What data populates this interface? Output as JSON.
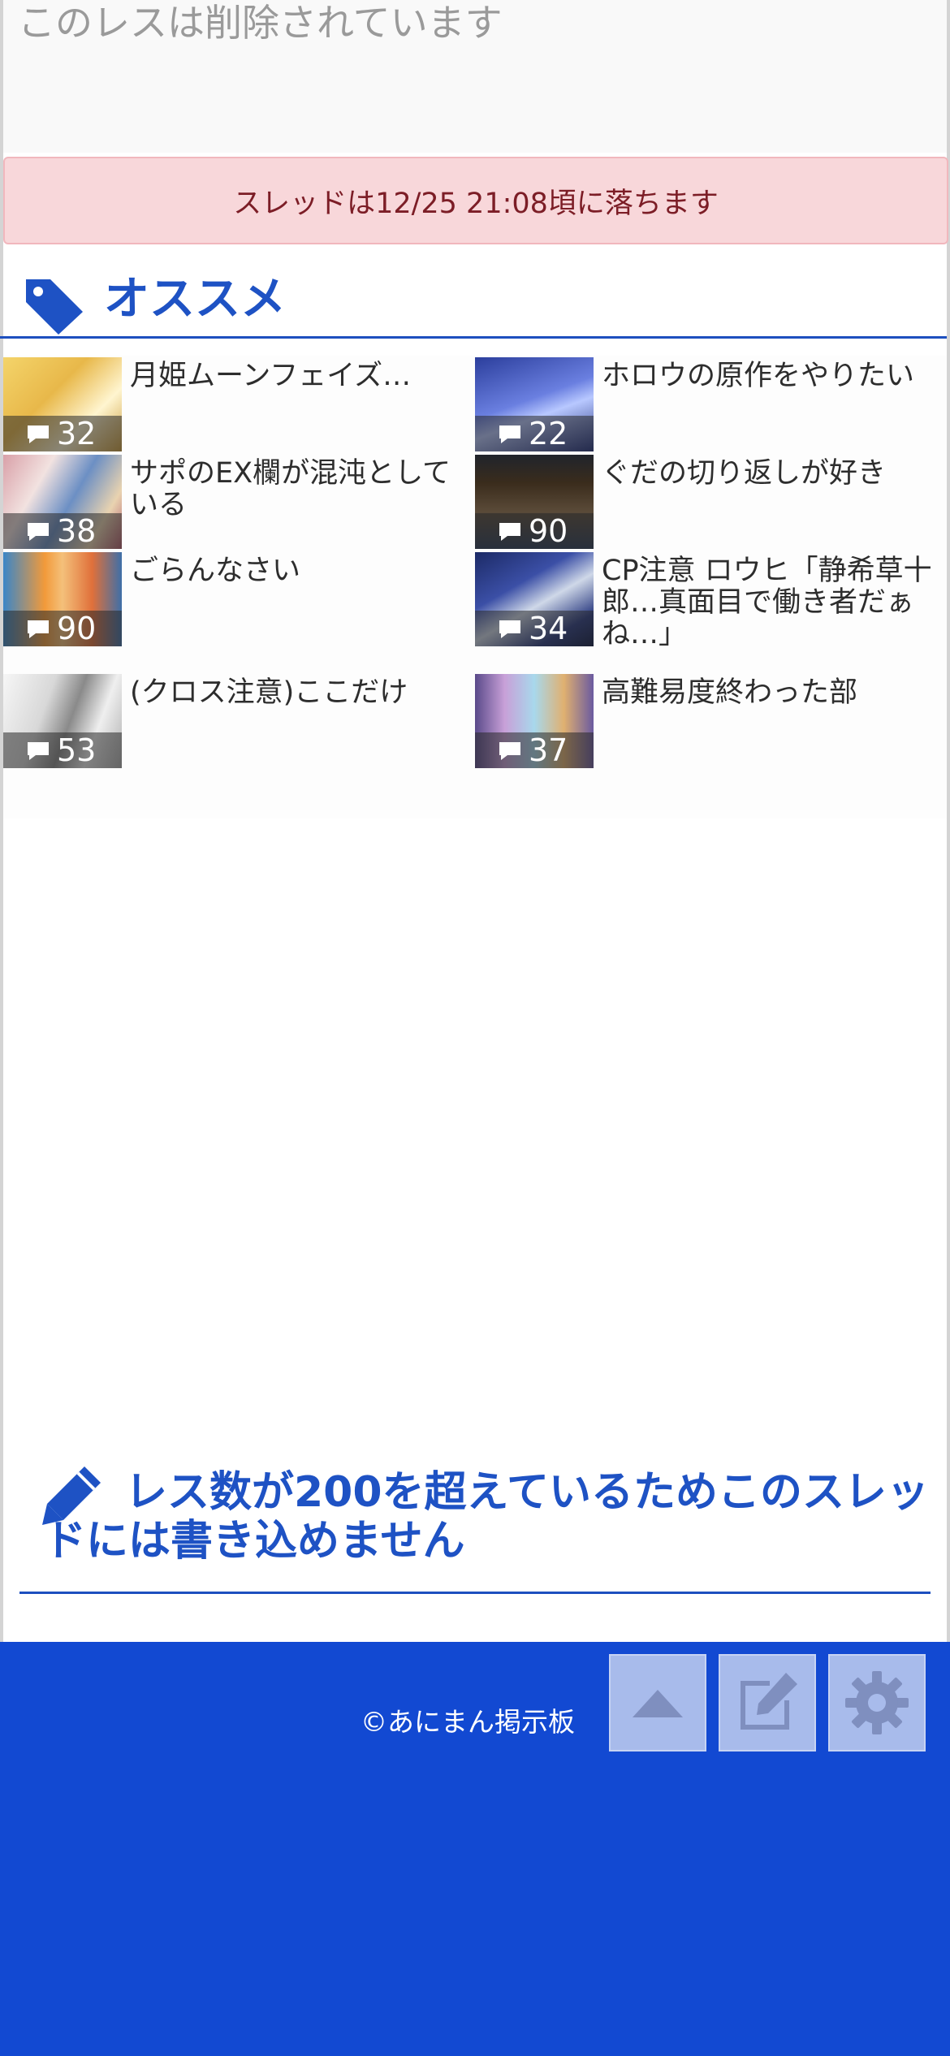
{
  "deleted_post": {
    "text": "このレスは削除されています"
  },
  "thread_notice": {
    "text": "スレッドは12/25 21:08頃に落ちます"
  },
  "recommend": {
    "title": "オススメ",
    "items": [
      {
        "title": "月姫ムーンフェイズ…",
        "count": "32"
      },
      {
        "title": "ホロウの原作をやりたい",
        "count": "22"
      },
      {
        "title": "サポのEX欄が混沌としている",
        "count": "38"
      },
      {
        "title": "ぐだの切り返しが好き",
        "count": "90"
      },
      {
        "title": "ごらんなさい",
        "count": "90"
      },
      {
        "title": "CP注意 ロウヒ「静希草十郎…真面目で働き者だぁね…」",
        "count": "34"
      },
      {
        "title": "(クロス注意)ここだけ",
        "count": "53"
      },
      {
        "title": "高難易度終わった部",
        "count": "37"
      }
    ]
  },
  "no_write": {
    "text": "レス数が200を超えているためこのスレッドには書き込めません"
  },
  "footer": {
    "copyright": "©あにまん掲示板",
    "buttons": {
      "top_icon": "caret-up-icon",
      "write_icon": "edit-icon",
      "settings_icon": "gear-icon"
    }
  },
  "colors": {
    "accent": "#1e52c4",
    "footer_bg": "#1249d2",
    "alert_bg": "#f8d7da",
    "alert_text": "#7c1d26"
  }
}
